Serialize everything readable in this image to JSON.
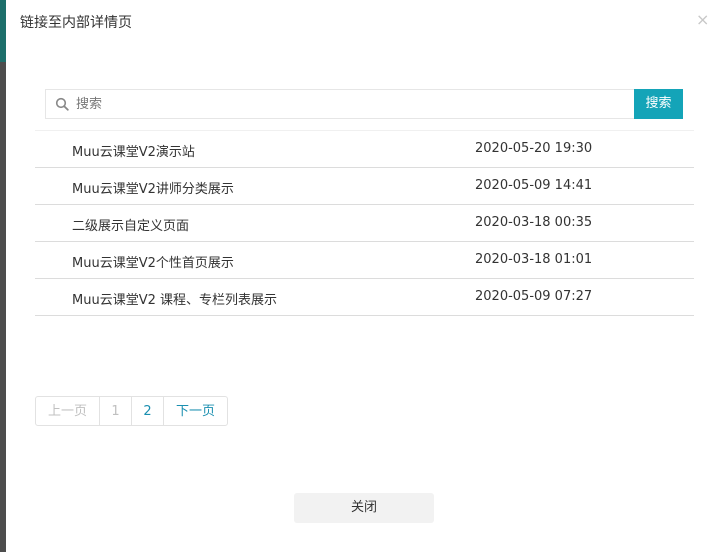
{
  "dialog": {
    "title": "链接至内部详情页",
    "close_glyph": "×"
  },
  "search": {
    "placeholder": "搜索",
    "value": "",
    "button_label": "搜索"
  },
  "list": {
    "rows": [
      {
        "name": "Muu云课堂V2演示站",
        "time": "2020-05-20 19:30"
      },
      {
        "name": "Muu云课堂V2讲师分类展示",
        "time": "2020-05-09 14:41"
      },
      {
        "name": "二级展示自定义页面",
        "time": "2020-03-18 00:35"
      },
      {
        "name": "Muu云课堂V2个性首页展示",
        "time": "2020-03-18 01:01"
      },
      {
        "name": "Muu云课堂V2 课程、专栏列表展示",
        "time": "2020-05-09 07:27"
      }
    ]
  },
  "pagination": {
    "prev_label": "上一页",
    "page1": "1",
    "page2": "2",
    "current_page": "2",
    "next_label": "下一页"
  },
  "footer": {
    "close_label": "关闭"
  },
  "colors": {
    "accent": "#14a4b8",
    "page_active": "#1a8fb0"
  },
  "icons": {
    "search": "search-icon",
    "close": "close-icon"
  }
}
